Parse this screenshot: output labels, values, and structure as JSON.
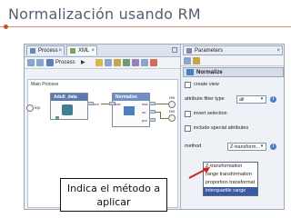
{
  "slide": {
    "title": "Normalización usando RM"
  },
  "process_pane": {
    "tabs": [
      {
        "label": "Process"
      },
      {
        "label": "XML"
      }
    ],
    "toolbar_label": "Process",
    "main_process_label": "Main Process",
    "left_port_label": "inp",
    "right_port_labels": [
      "res",
      "res"
    ],
    "operators": [
      {
        "name": "Adult_data",
        "output_ports": [
          "out"
        ],
        "header_color": "#5a79ad"
      },
      {
        "name": "Normalize",
        "input_ports": [
          "exa"
        ],
        "output_ports": [
          "exa",
          "ori",
          "pre"
        ],
        "header_color": "#6f8fc6"
      }
    ]
  },
  "parameters_pane": {
    "tab_label": "Parameters",
    "operator_header": "Normalize",
    "params": {
      "create_view": "create view",
      "attribute_filter_type": "attribute filter type",
      "attribute_filter_value": "all",
      "invert_selection": "invert selection",
      "include_special": "include special attributes",
      "method_label": "method",
      "method_value": "Z-transform..."
    },
    "method_options": [
      "Z-transformation",
      "range transformation",
      "proportion transformat",
      "interquartile range"
    ],
    "highlighted_option": "interquartile range"
  },
  "callout": {
    "line1": "Indica el método a",
    "line2": "aplicar"
  },
  "colors": {
    "accent_red": "#d02020",
    "highlight": "#3a5aa8"
  }
}
